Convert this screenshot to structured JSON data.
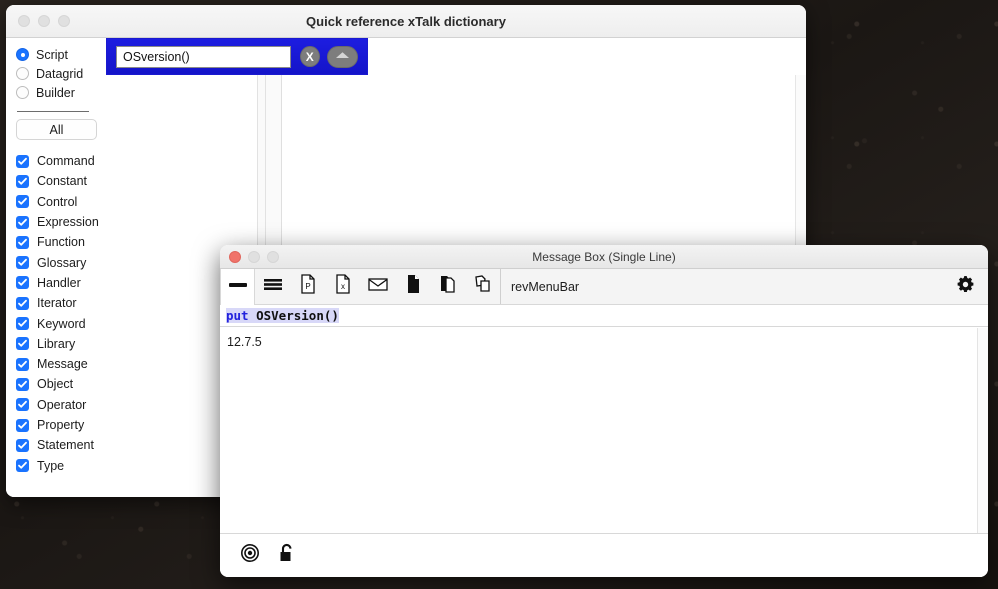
{
  "dictionary_window": {
    "title": "Quick reference xTalk dictionary",
    "traffic_lights": [
      "close-inactive",
      "minimize-inactive",
      "zoom-inactive"
    ],
    "radios": [
      {
        "label": "Script",
        "selected": true
      },
      {
        "label": "Datagrid",
        "selected": false
      },
      {
        "label": "Builder",
        "selected": false
      }
    ],
    "all_button": "All",
    "checkboxes": [
      {
        "label": "Command",
        "checked": true
      },
      {
        "label": "Constant",
        "checked": true
      },
      {
        "label": "Control",
        "checked": true
      },
      {
        "label": "Expression",
        "checked": true
      },
      {
        "label": "Function",
        "checked": true
      },
      {
        "label": "Glossary",
        "checked": true
      },
      {
        "label": "Handler",
        "checked": true
      },
      {
        "label": "Iterator",
        "checked": true
      },
      {
        "label": "Keyword",
        "checked": true
      },
      {
        "label": "Library",
        "checked": true
      },
      {
        "label": "Message",
        "checked": true
      },
      {
        "label": "Object",
        "checked": true
      },
      {
        "label": "Operator",
        "checked": true
      },
      {
        "label": "Property",
        "checked": true
      },
      {
        "label": "Statement",
        "checked": true
      },
      {
        "label": "Type",
        "checked": true
      }
    ],
    "search": {
      "value": "OSversion()",
      "placeholder": "",
      "clear_label": "X",
      "collapse_icon": "triangle-up-icon",
      "bar_color": "#1818d0"
    },
    "results_list": [],
    "detail_panel_text": ""
  },
  "message_box_window": {
    "title": "Message Box (Single Line)",
    "traffic_lights": [
      "close-active",
      "minimize-inactive",
      "zoom-inactive"
    ],
    "toolbar_icons": [
      {
        "name": "single-line-icon",
        "active": true
      },
      {
        "name": "multi-line-icon",
        "active": false
      },
      {
        "name": "powerpoint-doc-icon",
        "active": false
      },
      {
        "name": "excel-doc-icon",
        "active": false
      },
      {
        "name": "envelope-icon",
        "active": false
      },
      {
        "name": "filled-doc-icon",
        "active": false
      },
      {
        "name": "copy-docs-icon",
        "active": false
      },
      {
        "name": "overlap-docs-icon",
        "active": false
      }
    ],
    "menubar_value": "revMenuBar",
    "gear_icon": "gear-icon",
    "command_line": {
      "keyword": "put",
      "expression": "OSVersion()"
    },
    "output": "12.7.5",
    "bottom_icons": [
      {
        "name": "target-record-icon"
      },
      {
        "name": "unlock-padlock-icon"
      }
    ]
  }
}
